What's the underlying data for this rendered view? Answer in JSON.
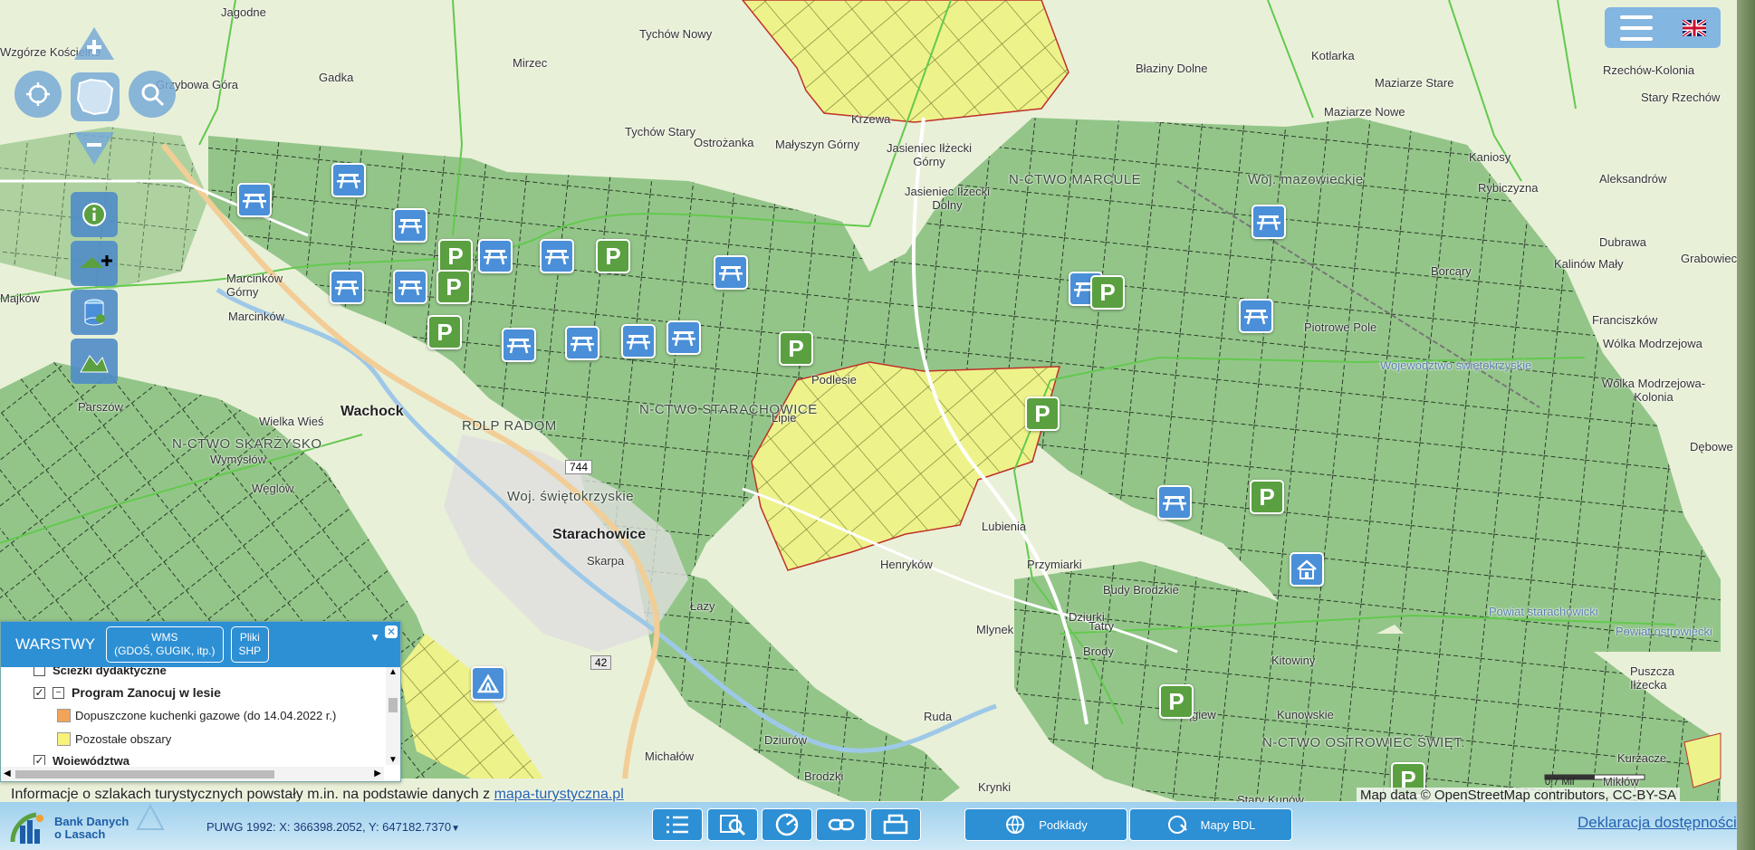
{
  "map": {
    "labels": [
      {
        "text": "Jagodne",
        "cls": ""
      },
      {
        "text": "Tychów Nowy",
        "cls": ""
      },
      {
        "text": "Błaziny Dolne",
        "cls": ""
      },
      {
        "text": "Kotlarka",
        "cls": ""
      },
      {
        "text": "Maziarze Stare",
        "cls": ""
      },
      {
        "text": "Rzechów-Kolonia",
        "cls": ""
      },
      {
        "text": "Stary Rzechów",
        "cls": ""
      },
      {
        "text": "Gadka",
        "cls": ""
      },
      {
        "text": "Mirzec",
        "cls": ""
      },
      {
        "text": "Grzybowa Góra",
        "cls": ""
      },
      {
        "text": "Krzewa",
        "cls": ""
      },
      {
        "text": "Maziarze Nowe",
        "cls": ""
      },
      {
        "text": "Tychów Stary",
        "cls": ""
      },
      {
        "text": "Ostrożanka",
        "cls": ""
      },
      {
        "text": "Małyszyn Górny",
        "cls": ""
      },
      {
        "text": "Jasieniec Iłżecki Górny",
        "cls": ""
      },
      {
        "text": "N-CTWO MARCULE",
        "cls": "region"
      },
      {
        "text": "Woj. mazowieckie",
        "cls": "region"
      },
      {
        "text": "Kaniosy",
        "cls": ""
      },
      {
        "text": "Rybiczyzna",
        "cls": ""
      },
      {
        "text": "Aleksandrów",
        "cls": ""
      },
      {
        "text": "Jasieniec Iłżecki Dolny",
        "cls": ""
      },
      {
        "text": "Borcąry",
        "cls": ""
      },
      {
        "text": "Dubrawa",
        "cls": ""
      },
      {
        "text": "Grabowiec",
        "cls": ""
      },
      {
        "text": "Kalinów Mały",
        "cls": ""
      },
      {
        "text": "Marcinków Górny",
        "cls": ""
      },
      {
        "text": "Majków",
        "cls": ""
      },
      {
        "text": "Marcinków",
        "cls": ""
      },
      {
        "text": "Piotrowe Pole",
        "cls": ""
      },
      {
        "text": "Franciszków",
        "cls": ""
      },
      {
        "text": "Wólka Modrzejowa",
        "cls": ""
      },
      {
        "text": "Województwo świętokrzyskie",
        "cls": "admin"
      },
      {
        "text": "Parszów",
        "cls": ""
      },
      {
        "text": "Wólka Modrzejowa-Kolonia",
        "cls": ""
      },
      {
        "text": "Wachock",
        "cls": "town"
      },
      {
        "text": "Wielka Wieś",
        "cls": ""
      },
      {
        "text": "RDLP RADOM",
        "cls": "region"
      },
      {
        "text": "N-CTWO STARACHOWICE",
        "cls": "region"
      },
      {
        "text": "Podlesie",
        "cls": ""
      },
      {
        "text": "Lipie",
        "cls": ""
      },
      {
        "text": "N-CTWO SKARŻYSKO",
        "cls": "region"
      },
      {
        "text": "Wymysłów",
        "cls": ""
      },
      {
        "text": "Dębowe",
        "cls": ""
      },
      {
        "text": "Węglów",
        "cls": ""
      },
      {
        "text": "Woj. świętokrzyskie",
        "cls": "region"
      },
      {
        "text": "Lubienia",
        "cls": ""
      },
      {
        "text": "Starachowice",
        "cls": "town"
      },
      {
        "text": "Skarpa",
        "cls": ""
      },
      {
        "text": "Przymiarki",
        "cls": ""
      },
      {
        "text": "Henryków",
        "cls": ""
      },
      {
        "text": "Budy Brodzkie",
        "cls": ""
      },
      {
        "text": "Łazy",
        "cls": ""
      },
      {
        "text": "Dziurki",
        "cls": ""
      },
      {
        "text": "Mlynek",
        "cls": ""
      },
      {
        "text": "Powiat starachowicki",
        "cls": "admin"
      },
      {
        "text": "Powiat ostrowiecki",
        "cls": "admin"
      },
      {
        "text": "Tatry",
        "cls": ""
      },
      {
        "text": "Brody",
        "cls": ""
      },
      {
        "text": "Kitowiny",
        "cls": ""
      },
      {
        "text": "Puszcza Iłżecka",
        "cls": ""
      },
      {
        "text": "Ruda",
        "cls": ""
      },
      {
        "text": "Połągiew",
        "cls": ""
      },
      {
        "text": "Kunowskie",
        "cls": ""
      },
      {
        "text": "Dziurów",
        "cls": ""
      },
      {
        "text": "Brodzki",
        "cls": ""
      },
      {
        "text": "N-CTWO OSTROWIEC ŚWIĘT.",
        "cls": "region"
      },
      {
        "text": "Michałów",
        "cls": ""
      },
      {
        "text": "Kurzacze",
        "cls": ""
      },
      {
        "text": "Krynki",
        "cls": ""
      },
      {
        "text": "Stary Kunów",
        "cls": ""
      },
      {
        "text": "Mikłów",
        "cls": ""
      },
      {
        "text": "Wzgórze Kościelne",
        "cls": ""
      }
    ],
    "road_shields": [
      {
        "text": "744"
      },
      {
        "text": "42"
      }
    ],
    "pois": [
      {
        "type": "picnic",
        "icon": "picnic-table-icon"
      },
      {
        "type": "picnic",
        "icon": "picnic-table-icon"
      },
      {
        "type": "picnic",
        "icon": "picnic-table-icon"
      },
      {
        "type": "parking",
        "icon": "parking-icon",
        "label": "P"
      },
      {
        "type": "picnic",
        "icon": "picnic-table-icon"
      },
      {
        "type": "picnic",
        "icon": "picnic-table-icon"
      },
      {
        "type": "parking",
        "icon": "parking-icon",
        "label": "P"
      },
      {
        "type": "picnic",
        "icon": "picnic-table-icon"
      },
      {
        "type": "picnic",
        "icon": "picnic-table-icon"
      },
      {
        "type": "parking",
        "icon": "parking-icon",
        "label": "P"
      },
      {
        "type": "picnic",
        "icon": "picnic-table-icon"
      },
      {
        "type": "parking",
        "icon": "parking-icon",
        "label": "P"
      },
      {
        "type": "picnic",
        "icon": "picnic-table-icon"
      },
      {
        "type": "picnic",
        "icon": "picnic-table-icon"
      },
      {
        "type": "picnic",
        "icon": "picnic-table-icon"
      },
      {
        "type": "picnic",
        "icon": "picnic-table-icon"
      },
      {
        "type": "parking",
        "icon": "parking-icon",
        "label": "P"
      },
      {
        "type": "picnic",
        "icon": "picnic-table-icon"
      },
      {
        "type": "parking",
        "icon": "parking-icon",
        "label": "P"
      },
      {
        "type": "picnic",
        "icon": "picnic-table-icon"
      },
      {
        "type": "picnic",
        "icon": "picnic-table-icon"
      },
      {
        "type": "parking",
        "icon": "parking-icon",
        "label": "P"
      },
      {
        "type": "picnic",
        "icon": "picnic-table-icon"
      },
      {
        "type": "parking",
        "icon": "parking-icon",
        "label": "P"
      },
      {
        "type": "lodge",
        "icon": "forest-lodge-icon"
      },
      {
        "type": "parking",
        "icon": "parking-icon",
        "label": "P"
      },
      {
        "type": "camp",
        "icon": "tent-icon"
      },
      {
        "type": "parking",
        "icon": "parking-icon",
        "label": "P"
      }
    ],
    "colors": {
      "forest": "#8fc483",
      "forest_lines": "#2d3d2a",
      "zanocuj": "#eef28a",
      "zanocuj_border": "#c0302a",
      "boundary": "#66cc55",
      "road": "#ffffff",
      "major_road": "#f4c98a"
    }
  },
  "layers_panel": {
    "title": "WARSTWY",
    "wms_button": "WMS\n(GDOŚ, GUGIK, itp.)",
    "wms_line1": "WMS",
    "wms_line2": "(GDOŚ, GUGIK, itp.)",
    "shp_line1": "Pliki",
    "shp_line2": "SHP",
    "items": [
      {
        "label": "Ścieżki dydaktyczne",
        "checked": false,
        "bold": true
      },
      {
        "label": "Program Zanocuj w lesie",
        "checked": true,
        "bold": true
      },
      {
        "label": "Dopuszczone kuchenki gazowe (do 14.04.2022 r.)",
        "swatch": "#f3a35a"
      },
      {
        "label": "Pozostałe obszary",
        "swatch": "#f7f27a"
      },
      {
        "label": "Województwa",
        "checked": true,
        "bold": true
      }
    ]
  },
  "info_text": "Informacje o szlakach turystycznych powstały m.in. na podstawie danych z ",
  "info_link": "mapa-turystyczna.pl",
  "attribution": "Map data © OpenStreetMap contributors, CC-BY-SA",
  "coordinates": "PUWG 1992: X: 366398.2052, Y: 647182.7370",
  "logo_text_1": "Bank Danych",
  "logo_text_2": "o Lasach",
  "bottom_buttons": {
    "basemaps": "Podkłady",
    "bdl_maps": "Mapy BDL"
  },
  "accessibility": "Deklaracja dostępności",
  "scale_label": "0.7 Mil"
}
